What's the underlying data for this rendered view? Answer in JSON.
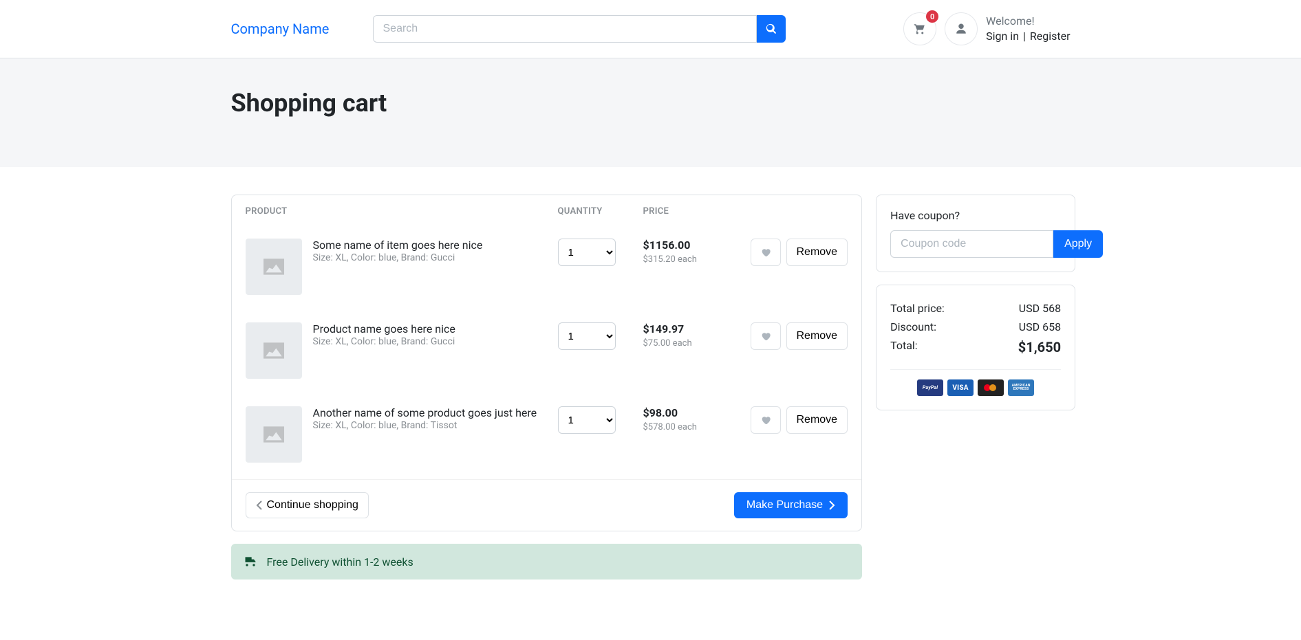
{
  "header": {
    "brand": "Company Name",
    "search_placeholder": "Search",
    "cart_count": "0",
    "welcome_text": "Welcome!",
    "signin_text": "Sign in",
    "register_text": "Register"
  },
  "page": {
    "title": "Shopping cart"
  },
  "table": {
    "col_product": "PRODUCT",
    "col_quantity": "QUANTITY",
    "col_price": "PRICE",
    "remove_label": "Remove"
  },
  "items": [
    {
      "title": "Some name of item goes here nice",
      "meta": "Size: XL, Color: blue, Brand: Gucci",
      "qty": "1",
      "price": "$1156.00",
      "each": "$315.20 each"
    },
    {
      "title": "Product name goes here nice",
      "meta": "Size: XL, Color: blue, Brand: Gucci",
      "qty": "1",
      "price": "$149.97",
      "each": "$75.00 each"
    },
    {
      "title": "Another name of some product goes just here",
      "meta": "Size: XL, Color: blue, Brand: Tissot",
      "qty": "1",
      "price": "$98.00",
      "each": "$578.00 each"
    }
  ],
  "footer": {
    "continue_label": "Continue shopping",
    "purchase_label": "Make Purchase"
  },
  "alert": {
    "text": "Free Delivery within 1-2 weeks"
  },
  "coupon": {
    "label": "Have coupon?",
    "placeholder": "Coupon code",
    "apply_label": "Apply"
  },
  "summary": {
    "total_price_label": "Total price:",
    "total_price_value": "USD 568",
    "discount_label": "Discount:",
    "discount_value": "USD 658",
    "total_label": "Total:",
    "total_value": "$1,650"
  },
  "paylogos": {
    "paypal": "PayPal",
    "visa": "VISA",
    "amex": "AMERICAN EXPRESS"
  }
}
